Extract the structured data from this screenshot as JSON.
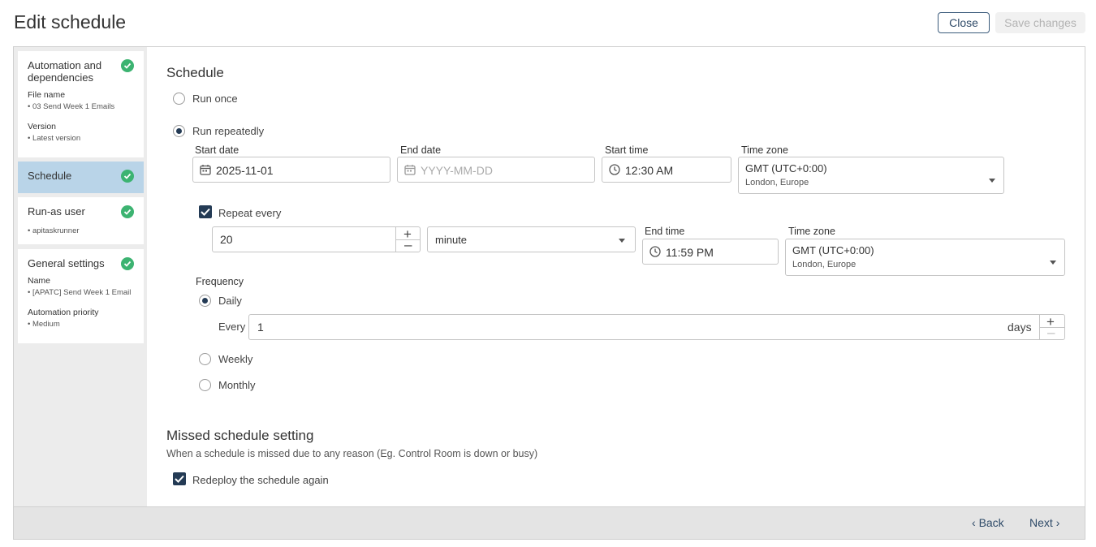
{
  "page": {
    "title": "Edit schedule"
  },
  "header": {
    "close_label": "Close",
    "save_label": "Save changes"
  },
  "sidebar": {
    "automation": {
      "title": "Automation and dependencies",
      "file_label": "File name",
      "file_value": "• 03 Send Week 1 Emails",
      "version_label": "Version",
      "version_value": "• Latest version"
    },
    "schedule": {
      "title": "Schedule"
    },
    "runas": {
      "title": "Run-as user",
      "value": "• apitaskrunner"
    },
    "general": {
      "title": "General settings",
      "name_label": "Name",
      "name_value": "• [APATC] Send Week 1 Email",
      "priority_label": "Automation priority",
      "priority_value": "• Medium"
    }
  },
  "schedule": {
    "heading": "Schedule",
    "run_once_label": "Run once",
    "run_repeatedly_label": "Run repeatedly",
    "start_date_label": "Start date",
    "start_date_value": "2025-11-01",
    "end_date_label": "End date",
    "end_date_placeholder": "YYYY-MM-DD",
    "start_time_label": "Start time",
    "start_time_value": "12:30 AM",
    "timezone_label": "Time zone",
    "timezone_value": "GMT (UTC+0:00)",
    "timezone_sub": "London, Europe",
    "repeat_every_label": "Repeat every",
    "repeat_value": "20",
    "repeat_unit": "minute",
    "end_time_label": "End time",
    "end_time_value": "11:59 PM",
    "timezone2_label": "Time zone",
    "timezone2_value": "GMT (UTC+0:00)",
    "timezone2_sub": "London, Europe",
    "frequency_label": "Frequency",
    "daily_label": "Daily",
    "every_label": "Every",
    "every_value": "1",
    "days_label": "days",
    "weekly_label": "Weekly",
    "monthly_label": "Monthly"
  },
  "missed": {
    "heading": "Missed schedule setting",
    "description": "When a schedule is missed due to any reason (Eg. Control Room is down or busy)",
    "redeploy_label": "Redeploy the schedule again"
  },
  "footer": {
    "back_label": "Back",
    "next_label": "Next"
  },
  "colors": {
    "accent": "#243b55",
    "success": "#3cb371",
    "active_bg": "#b9d4e8"
  }
}
